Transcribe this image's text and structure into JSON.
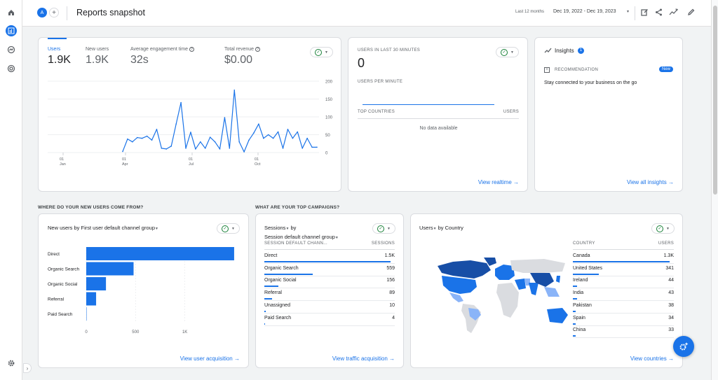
{
  "page": {
    "title": "Reports snapshot",
    "avatar": "A"
  },
  "header": {
    "date_label": "Last 12 months",
    "date_range": "Dec 19, 2022 - Dec 19, 2023"
  },
  "metrics": [
    {
      "label": "Users",
      "value": "1.9K"
    },
    {
      "label": "New users",
      "value": "1.9K"
    },
    {
      "label": "Average engagement time",
      "value": "32s"
    },
    {
      "label": "Total revenue",
      "value": "$0.00"
    }
  ],
  "chart_data": {
    "type": "line",
    "title": "",
    "xlabel": "",
    "ylabel": "",
    "ylim": [
      0,
      200
    ],
    "y_ticks": [
      "200",
      "150",
      "100",
      "50",
      "0"
    ],
    "x_ticks": [
      {
        "day": "01",
        "month": "Jan"
      },
      {
        "day": "01",
        "month": "Apr"
      },
      {
        "day": "01",
        "month": "Jul"
      },
      {
        "day": "01",
        "month": "Oct"
      }
    ],
    "series": [
      {
        "values": [
          3,
          38,
          30,
          42,
          40,
          46,
          35,
          65,
          12,
          10,
          18,
          80,
          140,
          12,
          57,
          10,
          30,
          12,
          43,
          30,
          10,
          98,
          12,
          175,
          30,
          2,
          35,
          55,
          80,
          40,
          50,
          40,
          58,
          12,
          65,
          40,
          58,
          12,
          40,
          15,
          15
        ]
      }
    ]
  },
  "realtime": {
    "title": "USERS IN LAST 30 MINUTES",
    "value": "0",
    "per_minute": "USERS PER MINUTE",
    "col_country": "TOP COUNTRIES",
    "col_users": "USERS",
    "empty": "No data available",
    "link": "View realtime"
  },
  "insights": {
    "title": "Insights",
    "count": "1",
    "rec_label": "RECOMMENDATION",
    "badge": "New",
    "text": "Stay connected to your business on the go",
    "link": "View all insights"
  },
  "sections": {
    "new_users": "WHERE DO YOUR NEW USERS COME FROM?",
    "campaigns": "WHAT ARE YOUR TOP CAMPAIGNS?"
  },
  "acquisition": {
    "title": "New users by First user default channel group",
    "x_ticks": [
      "0",
      "500",
      "1K"
    ],
    "link": "View user acquisition",
    "chart": {
      "type": "bar",
      "categories": [
        "Direct",
        "Organic Search",
        "Organic Social",
        "Referral",
        "Paid Search"
      ],
      "values": [
        1500,
        480,
        200,
        100,
        2
      ],
      "xlim": [
        0,
        1600
      ]
    }
  },
  "campaigns": {
    "title_line1": "Sessions",
    "title_by": "by",
    "title_line2": "Session default channel group",
    "col1": "SESSION DEFAULT CHANN...",
    "col2": "SESSIONS",
    "rows": [
      {
        "label": "Direct",
        "value": "1.5K",
        "frac": 0.97
      },
      {
        "label": "Organic Search",
        "value": "559",
        "frac": 0.37
      },
      {
        "label": "Organic Social",
        "value": "156",
        "frac": 0.11
      },
      {
        "label": "Referral",
        "value": "89",
        "frac": 0.06
      },
      {
        "label": "Unassigned",
        "value": "10",
        "frac": 0.01
      },
      {
        "label": "Paid Search",
        "value": "4",
        "frac": 0.005
      }
    ],
    "link": "View traffic acquisition"
  },
  "country": {
    "title": "Users",
    "title_by": "by Country",
    "col1": "COUNTRY",
    "col2": "USERS",
    "rows": [
      {
        "label": "Canada",
        "value": "1.3K",
        "frac": 0.96
      },
      {
        "label": "United States",
        "value": "341",
        "frac": 0.26
      },
      {
        "label": "Ireland",
        "value": "44",
        "frac": 0.04
      },
      {
        "label": "India",
        "value": "43",
        "frac": 0.04
      },
      {
        "label": "Pakistan",
        "value": "38",
        "frac": 0.03
      },
      {
        "label": "Spain",
        "value": "34",
        "frac": 0.03
      },
      {
        "label": "China",
        "value": "33",
        "frac": 0.03
      }
    ],
    "link": "View countries"
  },
  "colors": {
    "accent": "#1a73e8",
    "dark_blue": "#174ea6",
    "light_blue": "#8ab4f8",
    "grey_land": "#dadce0"
  }
}
